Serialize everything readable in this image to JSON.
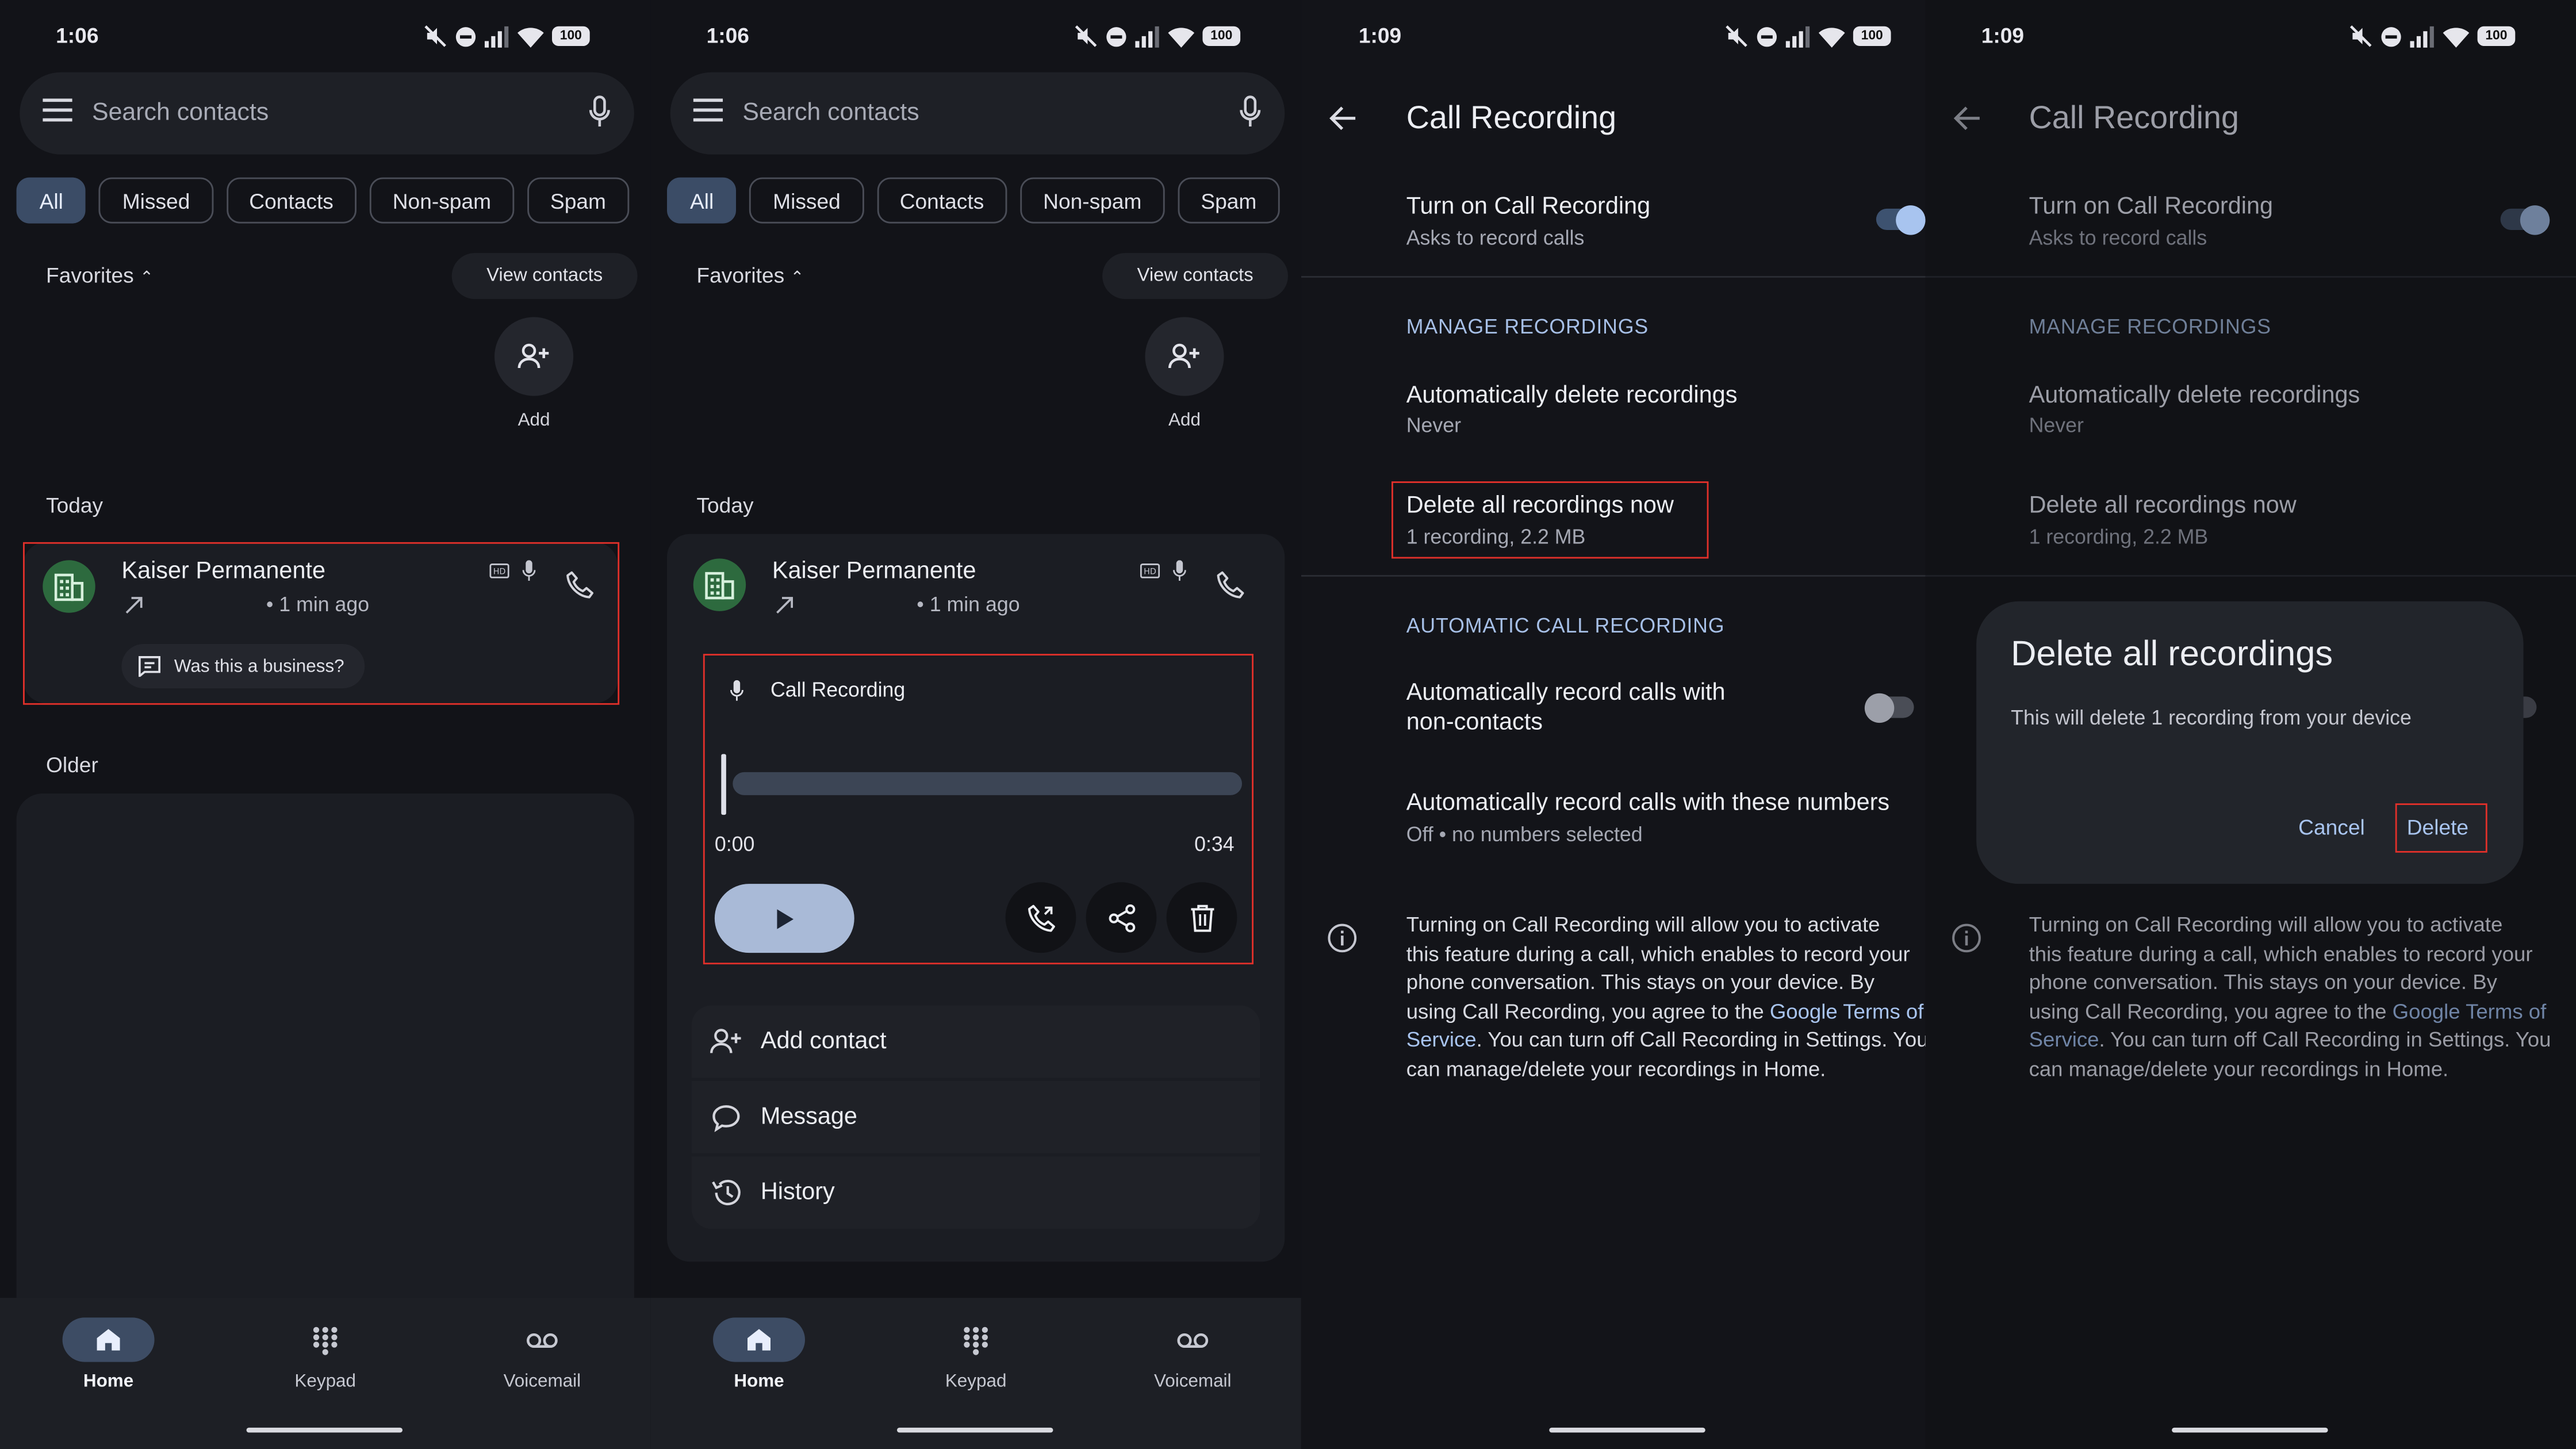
{
  "panels": [
    {
      "status": {
        "time": "1:06",
        "battery": "100"
      },
      "search": {
        "placeholder": "Search contacts"
      },
      "chips": [
        "All",
        "Missed",
        "Contacts",
        "Non-spam",
        "Spam"
      ],
      "favorites_label": "Favorites",
      "view_contacts": "View contacts",
      "add_label": "Add",
      "today_label": "Today",
      "call": {
        "name": "Kaiser Permanente",
        "time": "• 1 min ago"
      },
      "business_prompt": "Was this a business?",
      "older_label": "Older",
      "nav": [
        "Home",
        "Keypad",
        "Voicemail"
      ]
    },
    {
      "status": {
        "time": "1:06",
        "battery": "100"
      },
      "search": {
        "placeholder": "Search contacts"
      },
      "chips": [
        "All",
        "Missed",
        "Contacts",
        "Non-spam",
        "Spam"
      ],
      "favorites_label": "Favorites",
      "view_contacts": "View contacts",
      "add_label": "Add",
      "today_label": "Today",
      "call": {
        "name": "Kaiser Permanente",
        "time": "• 1 min ago"
      },
      "recording": {
        "title": "Call Recording",
        "start": "0:00",
        "end": "0:34",
        "progress": 0
      },
      "actions": [
        "Add contact",
        "Message",
        "History"
      ],
      "nav": [
        "Home",
        "Keypad",
        "Voicemail"
      ]
    },
    {
      "status": {
        "time": "1:09",
        "battery": "100"
      },
      "title": "Call Recording",
      "turn_on": {
        "title": "Turn on Call Recording",
        "subtitle": "Asks to record calls",
        "enabled": true
      },
      "manage_header": "MANAGE RECORDINGS",
      "auto_delete": {
        "title": "Automatically delete recordings",
        "subtitle": "Never"
      },
      "delete_all": {
        "title": "Delete all recordings now",
        "subtitle": "1 recording, 2.2 MB"
      },
      "auto_header": "AUTOMATIC CALL RECORDING",
      "non_contacts": {
        "line1": "Automatically record calls with",
        "line2": "non-contacts",
        "enabled": false
      },
      "these_numbers": {
        "title": "Automatically record calls with these numbers",
        "subtitle": "Off • no numbers selected"
      },
      "info": {
        "line1": "Turning on Call Recording will allow you to activate",
        "line2": "this feature during a call, which enables to record your",
        "line3": "phone conversation. This stays on your device. By",
        "line4a": "using Call Recording, you agree to the ",
        "link_a": "Google Terms of",
        "link_b": "Service",
        "line5b": ". You can turn off Call Recording in Settings. You",
        "line6": "can manage/delete your recordings in Home."
      }
    },
    {
      "status": {
        "time": "1:09",
        "battery": "100"
      },
      "title": "Call Recording",
      "turn_on": {
        "title": "Turn on Call Recording",
        "subtitle": "Asks to record calls"
      },
      "manage_header": "MANAGE RECORDINGS",
      "auto_delete": {
        "title": "Automatically delete recordings",
        "subtitle": "Never"
      },
      "delete_all": {
        "title": "Delete all recordings now",
        "subtitle": "1 recording, 2.2 MB"
      },
      "dialog": {
        "title": "Delete all recordings",
        "message": "This will delete 1 recording from your device",
        "cancel": "Cancel",
        "confirm": "Delete"
      },
      "info": {
        "line1": "Turning on Call Recording will allow you to activate",
        "line2": "this feature during a call, which enables to record your",
        "line3": "phone conversation. This stays on your device. By",
        "line4a": "using Call Recording, you agree to the ",
        "link_a": "Google Terms of",
        "link_b": "Service",
        "line5b": ". You can turn off Call Recording in Settings. You",
        "line6": "can manage/delete your recordings in Home."
      }
    }
  ],
  "theme": {
    "accent": "#a8c4ef",
    "highlight": "#e0302a",
    "avatar_bg": "#2d6a3e"
  }
}
